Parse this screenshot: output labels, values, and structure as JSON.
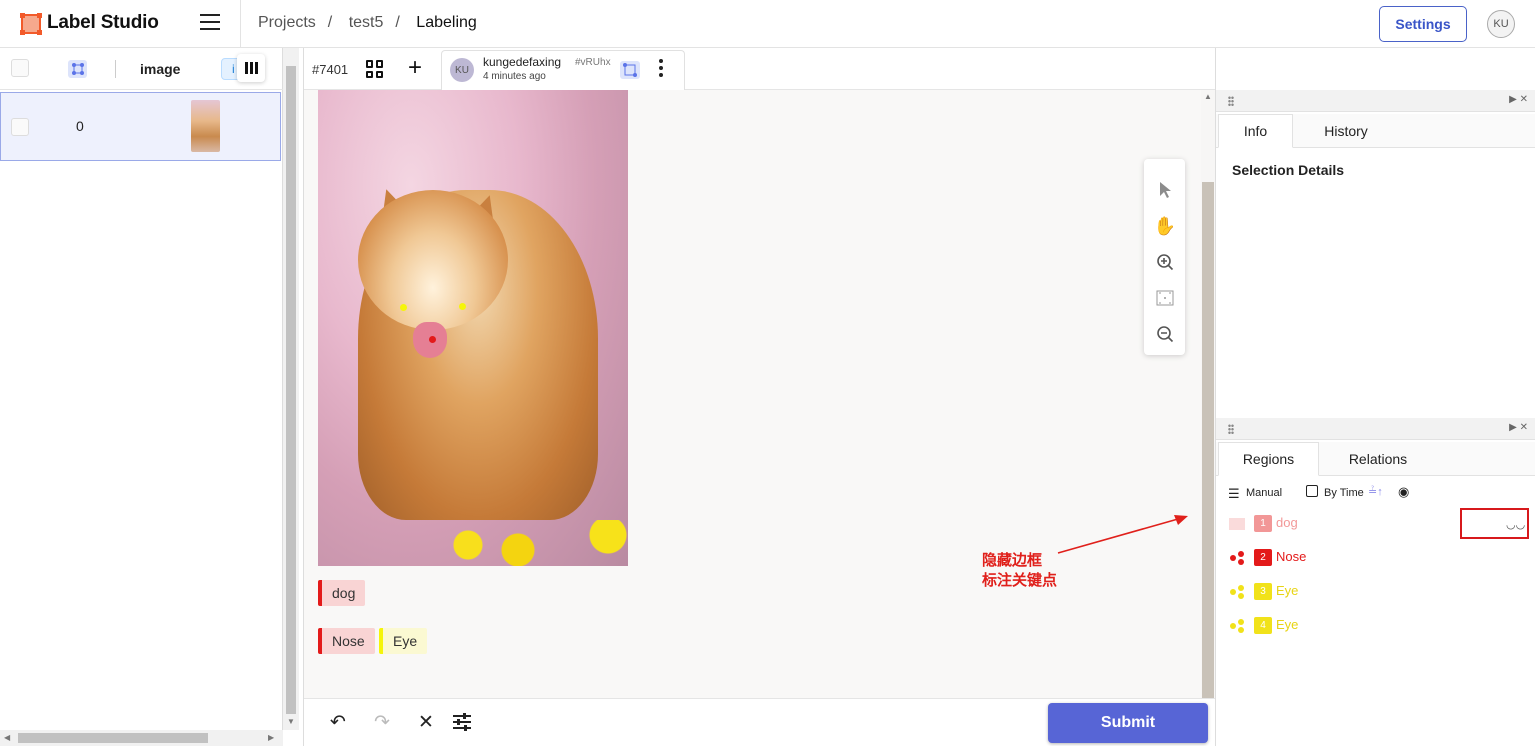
{
  "app": {
    "name": "Label Studio"
  },
  "breadcrumbs": [
    "Projects",
    "test5",
    "Labeling"
  ],
  "header": {
    "settings_label": "Settings",
    "user_initials": "KU"
  },
  "data_panel": {
    "columns": {
      "image": "image",
      "chip": "i"
    },
    "rows": [
      {
        "index": "0"
      }
    ]
  },
  "annotation": {
    "task_id": "#7401",
    "user": "kungedefaxing",
    "user_initials": "KU",
    "hash": "#vRUhx",
    "time": "4 minutes ago"
  },
  "labels": {
    "rect": [
      {
        "name": "dog",
        "color": "#e31a1a",
        "bg": "#f9d4d4"
      }
    ],
    "keypoints": [
      {
        "name": "Nose",
        "color": "#e31a1a",
        "bg": "#f9d4d4"
      },
      {
        "name": "Eye",
        "color": "#f5f50a",
        "bg": "#fbf9d2"
      }
    ]
  },
  "bottom": {
    "submit_label": "Submit"
  },
  "annotation_note": {
    "line1": "隐藏边框",
    "line2": "标注关键点",
    "color": "#e0201b"
  },
  "details_panel": {
    "tabs": [
      "Info",
      "History"
    ],
    "active_tab": "Info",
    "title": "Selection Details"
  },
  "regions_panel": {
    "tabs": [
      "Regions",
      "Relations"
    ],
    "active_tab": "Regions",
    "grouping": "Manual",
    "sort": "By Time",
    "regions": [
      {
        "num": "1",
        "label": "dog",
        "color": "#f1a3a3",
        "hidden": true
      },
      {
        "num": "2",
        "label": "Nose",
        "color": "#e31a1a",
        "hidden": false
      },
      {
        "num": "3",
        "label": "Eye",
        "color": "#f1e21a",
        "hidden": false
      },
      {
        "num": "4",
        "label": "Eye",
        "color": "#f1e21a",
        "hidden": false
      }
    ]
  },
  "icons": [
    "menu-icon",
    "grid-icon",
    "plus-icon",
    "keypoint-icon",
    "more-vertical-icon",
    "pointer-icon",
    "hand-icon",
    "zoom-in-icon",
    "fit-icon",
    "zoom-out-icon",
    "undo-icon",
    "redo-icon",
    "close-icon",
    "settings-sliders-icon",
    "eye-icon"
  ]
}
